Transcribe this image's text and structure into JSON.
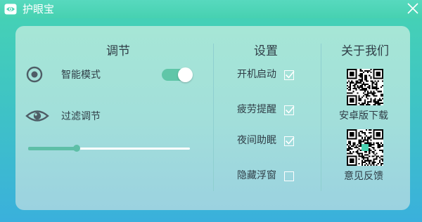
{
  "window": {
    "title": "护眼宝"
  },
  "colors": {
    "accent": "#5ebfa7",
    "title_bar": "#47d1b1",
    "panel": "#a2dfda",
    "text": "#2f3d46"
  },
  "adjust": {
    "heading": "调节",
    "smart_mode_label": "智能模式",
    "smart_mode_on": true,
    "filter_label": "过滤调节",
    "filter_level": 0.3
  },
  "settings": {
    "heading": "设置",
    "items": [
      {
        "label": "开机启动",
        "checked": true
      },
      {
        "label": "疲劳提醒",
        "checked": true
      },
      {
        "label": "夜间助眠",
        "checked": true
      },
      {
        "label": "隐藏浮窗",
        "checked": false
      }
    ]
  },
  "about": {
    "heading": "关于我们",
    "download_label": "安卓版下载",
    "feedback_label": "意见反馈"
  },
  "icons": {
    "app": "eye-logo-icon",
    "close": "close-icon",
    "smart_mode": "radio-target-icon",
    "filter": "eye-icon",
    "check": "check-icon"
  }
}
